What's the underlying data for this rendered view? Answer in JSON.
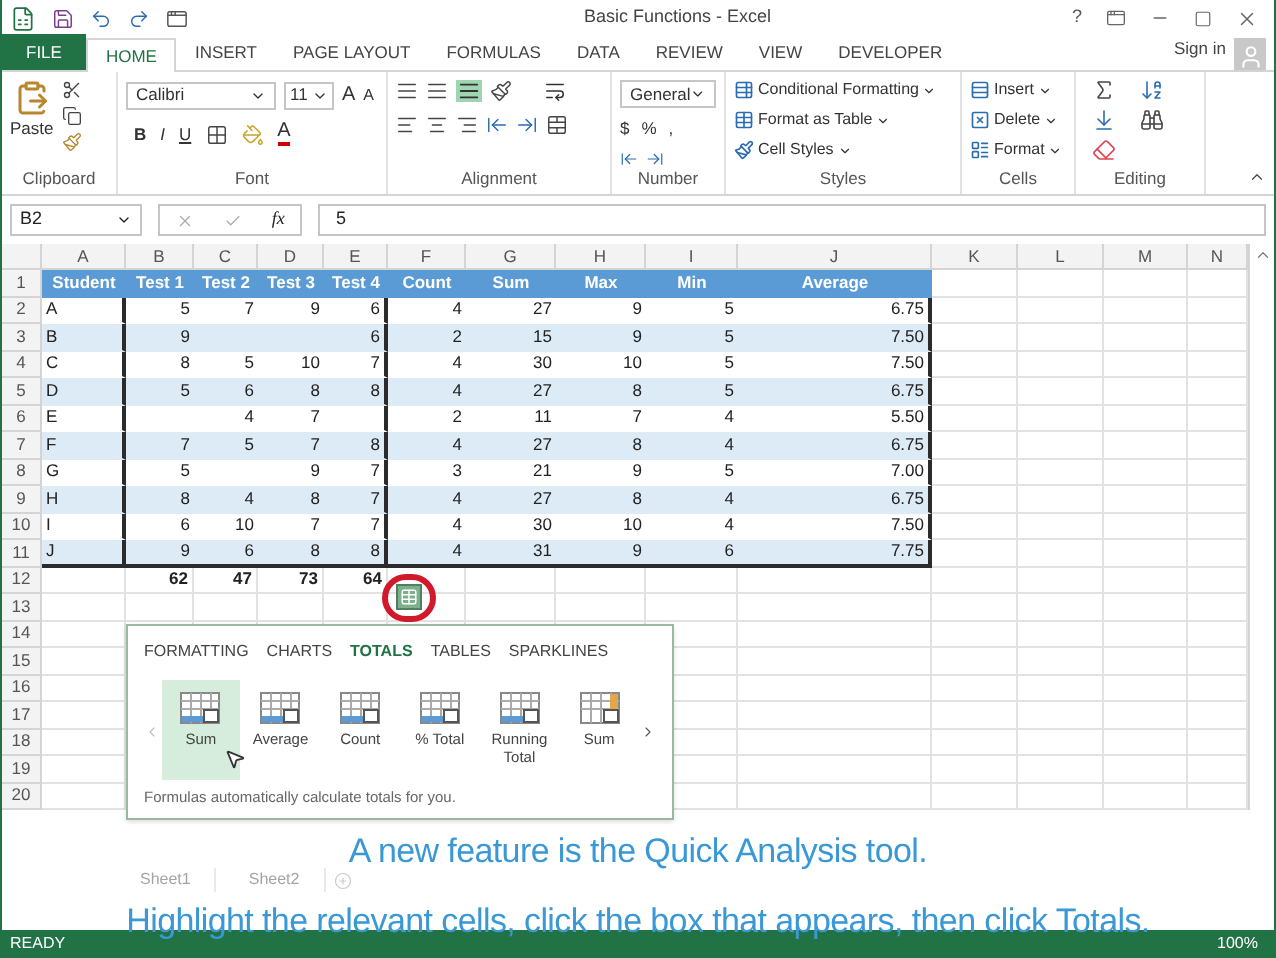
{
  "window": {
    "title": "Basic Functions - Excel",
    "help": "?"
  },
  "ribbon_tabs": [
    {
      "label": "FILE",
      "kind": "file",
      "selected": false
    },
    {
      "label": "HOME",
      "kind": "tab",
      "selected": true
    },
    {
      "label": "INSERT",
      "kind": "tab",
      "selected": false
    },
    {
      "label": "PAGE LAYOUT",
      "kind": "tab",
      "selected": false
    },
    {
      "label": "FORMULAS",
      "kind": "tab",
      "selected": false
    },
    {
      "label": "DATA",
      "kind": "tab",
      "selected": false
    },
    {
      "label": "REVIEW",
      "kind": "tab",
      "selected": false
    },
    {
      "label": "VIEW",
      "kind": "tab",
      "selected": false
    },
    {
      "label": "DEVELOPER",
      "kind": "tab",
      "selected": false
    }
  ],
  "sign_in": "Sign in",
  "ribbon": {
    "clipboard": {
      "paste": "Paste",
      "label": "Clipboard"
    },
    "font": {
      "name": "Calibri",
      "size": "11",
      "grow": "A",
      "shrink": "A",
      "bold": "B",
      "italic": "I",
      "underline": "U",
      "font_color_letter": "A",
      "label": "Font"
    },
    "alignment": {
      "label": "Alignment"
    },
    "number": {
      "format": "General",
      "currency": "$",
      "percent": "%",
      "comma": ",",
      "label": "Number"
    },
    "styles": {
      "items": [
        "Conditional Formatting",
        "Format as Table",
        "Cell Styles"
      ],
      "label": "Styles"
    },
    "cells": {
      "items": [
        "Insert",
        "Delete",
        "Format"
      ],
      "label": "Cells"
    },
    "editing": {
      "label": "Editing"
    }
  },
  "formula_bar": {
    "name_box": "B2",
    "function": "fx",
    "value": "5"
  },
  "sheet": {
    "columns": [
      "A",
      "B",
      "C",
      "D",
      "E",
      "F",
      "G",
      "H",
      "I",
      "J",
      "K",
      "L",
      "M",
      "N"
    ],
    "rows": [
      {
        "number": "1",
        "kind": "header",
        "cells": [
          "Student",
          "Test 1",
          "Test 2",
          "Test 3",
          "Test 4",
          "Count",
          "Sum",
          "Max",
          "Min",
          "Average"
        ]
      },
      {
        "number": "2",
        "kind": "data",
        "cells": [
          "A",
          "5",
          "7",
          "9",
          "6",
          "4",
          "27",
          "9",
          "5",
          "6.75"
        ]
      },
      {
        "number": "3",
        "kind": "data",
        "cells": [
          "B",
          "9",
          "",
          "",
          "6",
          "2",
          "15",
          "9",
          "5",
          "7.50"
        ]
      },
      {
        "number": "4",
        "kind": "data",
        "cells": [
          "C",
          "8",
          "5",
          "10",
          "7",
          "4",
          "30",
          "10",
          "5",
          "7.50"
        ]
      },
      {
        "number": "5",
        "kind": "data",
        "cells": [
          "D",
          "5",
          "6",
          "8",
          "8",
          "4",
          "27",
          "8",
          "5",
          "6.75"
        ]
      },
      {
        "number": "6",
        "kind": "data",
        "cells": [
          "E",
          "",
          "4",
          "7",
          "",
          "2",
          "11",
          "7",
          "4",
          "5.50"
        ]
      },
      {
        "number": "7",
        "kind": "data",
        "cells": [
          "F",
          "7",
          "5",
          "7",
          "8",
          "4",
          "27",
          "8",
          "4",
          "6.75"
        ]
      },
      {
        "number": "8",
        "kind": "data",
        "cells": [
          "G",
          "5",
          "",
          "9",
          "7",
          "3",
          "21",
          "9",
          "5",
          "7.00"
        ]
      },
      {
        "number": "9",
        "kind": "data",
        "cells": [
          "H",
          "8",
          "4",
          "8",
          "7",
          "4",
          "27",
          "8",
          "4",
          "6.75"
        ]
      },
      {
        "number": "10",
        "kind": "data",
        "cells": [
          "I",
          "6",
          "10",
          "7",
          "7",
          "4",
          "30",
          "10",
          "4",
          "7.50"
        ]
      },
      {
        "number": "11",
        "kind": "data",
        "cells": [
          "J",
          "9",
          "6",
          "8",
          "8",
          "4",
          "31",
          "9",
          "6",
          "7.75"
        ]
      },
      {
        "number": "12",
        "kind": "total",
        "cells": [
          "",
          "62",
          "47",
          "73",
          "64"
        ]
      },
      {
        "number": "13",
        "kind": "empty",
        "cells": []
      },
      {
        "number": "14",
        "kind": "empty",
        "cells": []
      },
      {
        "number": "15",
        "kind": "empty",
        "cells": []
      },
      {
        "number": "16",
        "kind": "empty",
        "cells": []
      },
      {
        "number": "17",
        "kind": "empty",
        "cells": []
      },
      {
        "number": "18",
        "kind": "empty",
        "cells": []
      },
      {
        "number": "19",
        "kind": "empty",
        "cells": []
      },
      {
        "number": "20",
        "kind": "empty",
        "cells": []
      }
    ]
  },
  "quick_analysis": {
    "tabs": [
      {
        "label": "FORMATTING",
        "selected": false
      },
      {
        "label": "CHARTS",
        "selected": false
      },
      {
        "label": "TOTALS",
        "selected": true
      },
      {
        "label": "TABLES",
        "selected": false
      },
      {
        "label": "SPARKLINES",
        "selected": false
      }
    ],
    "items": [
      {
        "label": "Sum",
        "kind": "row",
        "selected": true
      },
      {
        "label": "Average",
        "kind": "row",
        "selected": false
      },
      {
        "label": "Count",
        "kind": "row",
        "selected": false
      },
      {
        "label": "% Total",
        "kind": "row",
        "selected": false
      },
      {
        "label": "Running Total",
        "kind": "row",
        "selected": false
      },
      {
        "label": "Sum",
        "kind": "column",
        "selected": false
      }
    ],
    "footer": "Formulas automatically calculate totals for you."
  },
  "sheet_tabs": [
    "Sheet1",
    "Sheet2"
  ],
  "status_bar": {
    "mode": "READY",
    "zoom": "100%"
  },
  "caption": [
    "A new feature is the Quick Analysis tool.",
    "Highlight the relevant cells, click the box that appears, then click Totals."
  ]
}
